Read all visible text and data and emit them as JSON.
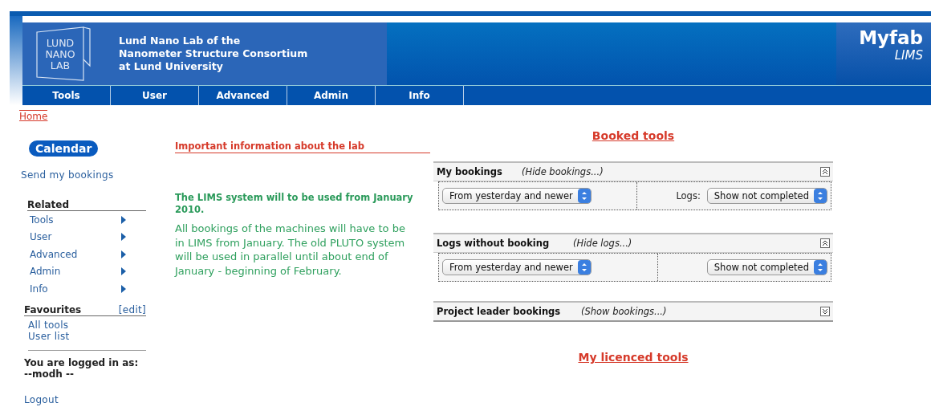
{
  "header": {
    "logo_lines": [
      "LUND",
      "NANO",
      "LAB"
    ],
    "org_lines": [
      "Lund Nano Lab of the",
      "Nanometer Structure Consortium",
      "at Lund University"
    ],
    "brand": "Myfab",
    "brand_sub": "LIMS"
  },
  "nav": [
    {
      "label": "Tools"
    },
    {
      "label": "User"
    },
    {
      "label": "Advanced"
    },
    {
      "label": "Admin"
    },
    {
      "label": "Info"
    }
  ],
  "breadcrumb": "Home",
  "sidebar": {
    "calendar": "Calendar",
    "send": "Send my bookings",
    "related_title": "Related",
    "related": [
      {
        "label": "Tools"
      },
      {
        "label": "User"
      },
      {
        "label": "Advanced"
      },
      {
        "label": "Admin"
      },
      {
        "label": "Info"
      }
    ],
    "favourites_title": "Favourites",
    "favourites_edit": "[edit]",
    "favourites": [
      "All tools",
      "User list"
    ],
    "logged_in_label": "You are logged in as:",
    "user": "--modh --",
    "logout": "Logout"
  },
  "info": {
    "title": "Important information about the lab",
    "headline": "The LIMS system will to be used from January 2010.",
    "body": "All bookings of the machines will have to be in LIMS from January. The old PLUTO system will be used in parallel until about end of January - beginning of February."
  },
  "booked_title": "Booked tools",
  "panels": [
    {
      "title": "My bookings",
      "toggle": "(Hide bookings...)",
      "expanded": true,
      "range": "From yesterday and newer",
      "logs_label": "Logs:",
      "logs": "Show not completed"
    },
    {
      "title": "Logs without booking",
      "toggle": "(Hide logs...)",
      "expanded": true,
      "range": "From yesterday and newer",
      "logs": "Show not completed"
    },
    {
      "title": "Project leader bookings",
      "toggle": "(Show bookings...)",
      "expanded": false
    }
  ],
  "licenced_title": "My licenced tools"
}
